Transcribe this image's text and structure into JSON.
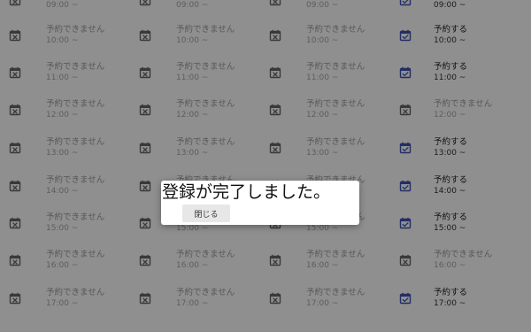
{
  "unavailable_label": "予約できません",
  "available_label": "予約する",
  "columns": [
    {
      "slots": [
        {
          "time": "09:00 ~",
          "available": false
        },
        {
          "time": "10:00 ~",
          "available": false
        },
        {
          "time": "11:00 ~",
          "available": false
        },
        {
          "time": "12:00 ~",
          "available": false
        },
        {
          "time": "13:00 ~",
          "available": false
        },
        {
          "time": "14:00 ~",
          "available": false
        },
        {
          "time": "15:00 ~",
          "available": false
        },
        {
          "time": "16:00 ~",
          "available": false
        },
        {
          "time": "17:00 ~",
          "available": false
        }
      ]
    },
    {
      "slots": [
        {
          "time": "09:00 ~",
          "available": false
        },
        {
          "time": "10:00 ~",
          "available": false
        },
        {
          "time": "11:00 ~",
          "available": false
        },
        {
          "time": "12:00 ~",
          "available": false
        },
        {
          "time": "13:00 ~",
          "available": false
        },
        {
          "time": "14:00 ~",
          "available": false
        },
        {
          "time": "15:00 ~",
          "available": false
        },
        {
          "time": "16:00 ~",
          "available": false
        },
        {
          "time": "17:00 ~",
          "available": false
        }
      ]
    },
    {
      "slots": [
        {
          "time": "09:00 ~",
          "available": false
        },
        {
          "time": "10:00 ~",
          "available": false
        },
        {
          "time": "11:00 ~",
          "available": false
        },
        {
          "time": "12:00 ~",
          "available": false
        },
        {
          "time": "13:00 ~",
          "available": false
        },
        {
          "time": "14:00 ~",
          "available": false
        },
        {
          "time": "15:00 ~",
          "available": false
        },
        {
          "time": "16:00 ~",
          "available": false
        },
        {
          "time": "17:00 ~",
          "available": false
        }
      ]
    },
    {
      "slots": [
        {
          "time": "09:00 ~",
          "available": true
        },
        {
          "time": "10:00 ~",
          "available": true
        },
        {
          "time": "11:00 ~",
          "available": true
        },
        {
          "time": "12:00 ~",
          "available": false
        },
        {
          "time": "13:00 ~",
          "available": true
        },
        {
          "time": "14:00 ~",
          "available": true
        },
        {
          "time": "15:00 ~",
          "available": true
        },
        {
          "time": "16:00 ~",
          "available": false
        },
        {
          "time": "17:00 ~",
          "available": true
        }
      ]
    }
  ],
  "icons": {
    "unavailable": "calendar-x-icon",
    "available": "calendar-check-icon"
  },
  "colors": {
    "available_icon": "#3f51b5",
    "unavailable_icon": "#666666",
    "overlay": "rgba(0,0,0,0.44)"
  },
  "dialog": {
    "message": "登録が完了しました。",
    "close_label": "閉じる"
  }
}
